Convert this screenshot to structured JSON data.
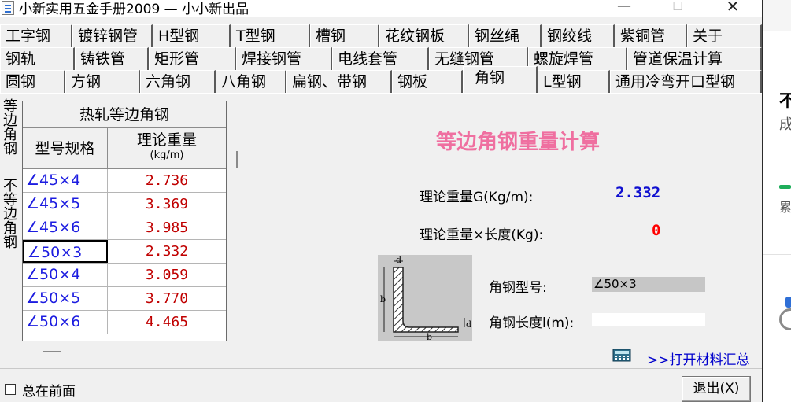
{
  "window": {
    "title": "小新实用五金手册2009 — 小小新出品",
    "minimize_glyph": "—",
    "maximize_glyph": "☐",
    "close_glyph": "✕"
  },
  "tabs": {
    "row1": [
      "工字钢",
      "镀锌钢管",
      "H型钢",
      "T型钢",
      "槽钢",
      "花纹钢板",
      "钢丝绳",
      "钢绞线",
      "紫铜管",
      "关于"
    ],
    "row2": [
      "钢轨",
      "铸铁管",
      "矩形管",
      "焊接钢管",
      "电线套管",
      "无缝钢管",
      "螺旋焊管",
      "管道保温计算"
    ],
    "row3": [
      "圆钢",
      "方钢",
      "六角钢",
      "八角钢",
      "扁钢、带钢",
      "钢板",
      "角钢",
      "L型钢",
      "通用冷弯开口型钢"
    ],
    "selected": "角钢"
  },
  "side_tabs": [
    "等边角钢",
    "不等边角钢"
  ],
  "table": {
    "title": "热轧等边角钢",
    "col_spec": "型号规格",
    "col_weight": "理论重量",
    "col_weight_unit": "(kg/m)",
    "rows": [
      {
        "spec": "∠45×4",
        "weight": "2.736"
      },
      {
        "spec": "∠45×5",
        "weight": "3.369"
      },
      {
        "spec": "∠45×6",
        "weight": "3.985"
      },
      {
        "spec": "∠50×3",
        "weight": "2.332"
      },
      {
        "spec": "∠50×4",
        "weight": "3.059"
      },
      {
        "spec": "∠50×5",
        "weight": "3.770"
      },
      {
        "spec": "∠50×6",
        "weight": "4.465"
      }
    ],
    "selected_index": 3
  },
  "calc": {
    "title": "等边角钢重量计算",
    "g_label": "理论重量G(Kg/m):",
    "g_value": "2.332",
    "gl_label": "理论重量×长度(Kg):",
    "gl_value": "0",
    "type_label": "角钢型号:",
    "type_value": "∠50×3",
    "length_label": "角钢长度l(m):",
    "length_value": "",
    "diagram_labels": {
      "d_top": "d",
      "b_side": "b",
      "d_right": "d",
      "b_bottom": "b"
    }
  },
  "summary_link": ">>打开材料汇总",
  "footer": {
    "on_top_label": "总在前面",
    "exit_label": "退出(X)"
  },
  "background_window": {
    "text1": "不",
    "text2": "成",
    "text3": "累"
  }
}
